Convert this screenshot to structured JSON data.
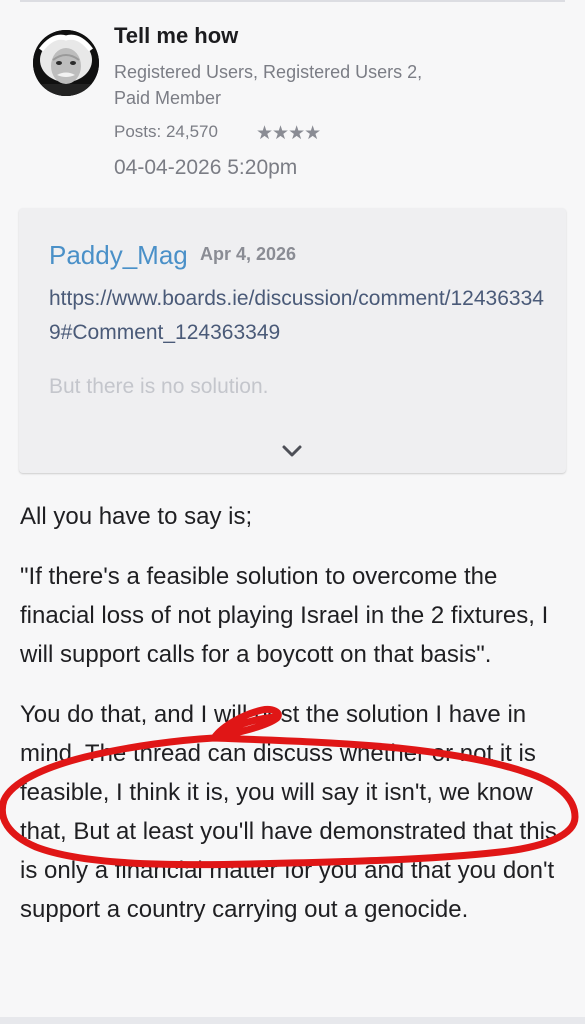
{
  "post": {
    "author": {
      "name": "Tell me how",
      "roles": "Registered Users, Registered Users 2, Paid Member",
      "posts": "Posts: 24,570",
      "stars": "★★★★",
      "avatar_icon": "portrait-avatar-icon"
    },
    "timestamp": "04-04-2026 5:20pm",
    "quote": {
      "author": "Paddy_Mag",
      "date": "Apr 4, 2026",
      "link": "https://www.boards.ie/discussion/comment/124363349#Comment_124363349",
      "body": "But there is no solution.",
      "expand_icon": "chevron-down-icon"
    },
    "paragraphs": [
      "All you have to say is;",
      "\"If there's a feasible solution to overcome the finacial loss of not playing Israel in the 2 fixtures, I will support calls for a boycott on that basis\".",
      "You do that, and I will post the solution I have in mind. The thread can discuss whether or not it is feasible, I think it is, you will say it isn't, we know that, But at least you'll have demonstrated that this is only a financial matter for you and that you don't support a country carrying out a genocide."
    ]
  },
  "colors": {
    "link": "#4a90c8",
    "annotation": "#e01616"
  }
}
